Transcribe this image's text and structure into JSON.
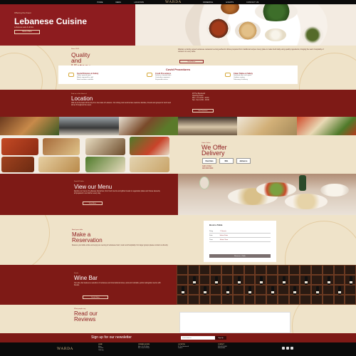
{
  "brand": {
    "logo_text": "WARDA"
  },
  "nav": {
    "left": [
      "HOME",
      "MENU",
      "LOCATION"
    ],
    "right": [
      "ORDERING",
      "EVENTS",
      "CONTACT US"
    ]
  },
  "hero": {
    "kicker": "Offering the finest",
    "title": "Lebanese Cuisine",
    "subtitle": "Lebanese eats & drinks",
    "button": "Book a Table"
  },
  "quality": {
    "kicker": "Since 2012",
    "title_line1": "Quality",
    "title_line2": "and",
    "title_line3": "History",
    "paragraph": "Warda is a family-owned Lebanese restaurant serving authentic dishes prepared from traditional recipes. Every plate is made fresh daily using quality ingredients, bringing the warm hospitality of Lebanon to every table.",
    "button": "Read More"
  },
  "covid": {
    "title": "Covid Procedures",
    "cols": [
      {
        "head": "Social Distance & Safety",
        "lines": [
          "Tables spaced apart",
          "Masks required for staff",
          "Hand sanitizer available"
        ]
      },
      {
        "head": "Covid Procedures",
        "lines": [
          "Surfaces cleaned often",
          "Contactless payment",
          "Disposable menus"
        ]
      },
      {
        "head": "Clean Tables & Safety",
        "lines": [
          "Sanitized after each guest",
          "Outdoor seating",
          "Takeaway & delivery"
        ]
      }
    ]
  },
  "location": {
    "kicker": "Find us in the Heart of",
    "title": "Location",
    "paragraph": "Visit us in the heart of the city for a true taste of Lebanon. Our dining room and terrace welcome families, friends and groups for lunch and dinner throughout the week.",
    "info": [
      "29 The Boulevard",
      "Opening Hours:",
      "Mon - Fri  12:00 - 23:00",
      "Sat - Sun  12:00 - 00:00"
    ],
    "button": "Get Directions"
  },
  "delivery": {
    "kicker": "Order Online",
    "title_line1": "We Offer",
    "title_line2": "Delivery",
    "partners": [
      "Uber Eats",
      "DEL",
      "deliveroo"
    ],
    "phone_lines": [
      "Call to Order:",
      "020 0000 0000"
    ]
  },
  "menu": {
    "kicker": "Food & Drinks",
    "title": "View our Menu",
    "paragraph": "Explore our menu of Lebanese favourites, from fresh mezze and grilled meats to vegetarian plates and house desserts, all prepared in our kitchen every day.",
    "button": "View Menu"
  },
  "reservation": {
    "kicker": "Book your table",
    "title_line1": "Make a",
    "title_line2": "Reservation",
    "paragraph": "Reserve your table online and enjoy an evening of Lebanese food, music and hospitality. For larger groups please contact us directly.",
    "form": {
      "title": "Book a Table",
      "rows": [
        {
          "label": "Party",
          "value": "2 Guests"
        },
        {
          "label": "Date",
          "value": "Select Date"
        },
        {
          "label": "Time",
          "value": "Select Time"
        }
      ],
      "button": "Reserve a Table"
    }
  },
  "wine": {
    "kicker": "Drinks",
    "title": "Wine Bar",
    "paragraph": "Our wine bar features a selection of Lebanese and international wines, arak and cocktails, perfect alongside mezze with friends.",
    "button": "Drinks Menu"
  },
  "reviews": {
    "kicker": "What people say",
    "title_line1": "Read our",
    "title_line2": "Reviews"
  },
  "newsletter": {
    "title": "Sign up for our newsletter",
    "placeholder": "Email Address",
    "button": "Sign Up"
  },
  "footer": {
    "cols": [
      {
        "head": "HOME",
        "lines": [
          "Menu",
          "Location",
          "Ordering"
        ]
      },
      {
        "head": "OPENING HOURS",
        "lines": [
          "Mon - Fri 12-11pm",
          "Sat - Sun 12-12am"
        ]
      },
      {
        "head": "LOCATION",
        "lines": [
          "29 The Boulevard",
          "London"
        ]
      },
      {
        "head": "CONTACT",
        "lines": [
          "020 0000 0000",
          "info@warda"
        ]
      }
    ],
    "social_icons": [
      "facebook-icon",
      "instagram-icon",
      "twitter-icon"
    ]
  },
  "colors": {
    "maroon": "#7e1a16",
    "hero_red": "#8d1c1f",
    "cream": "#efe3c9",
    "gold": "#d7b98a",
    "black": "#0b0b0b"
  }
}
